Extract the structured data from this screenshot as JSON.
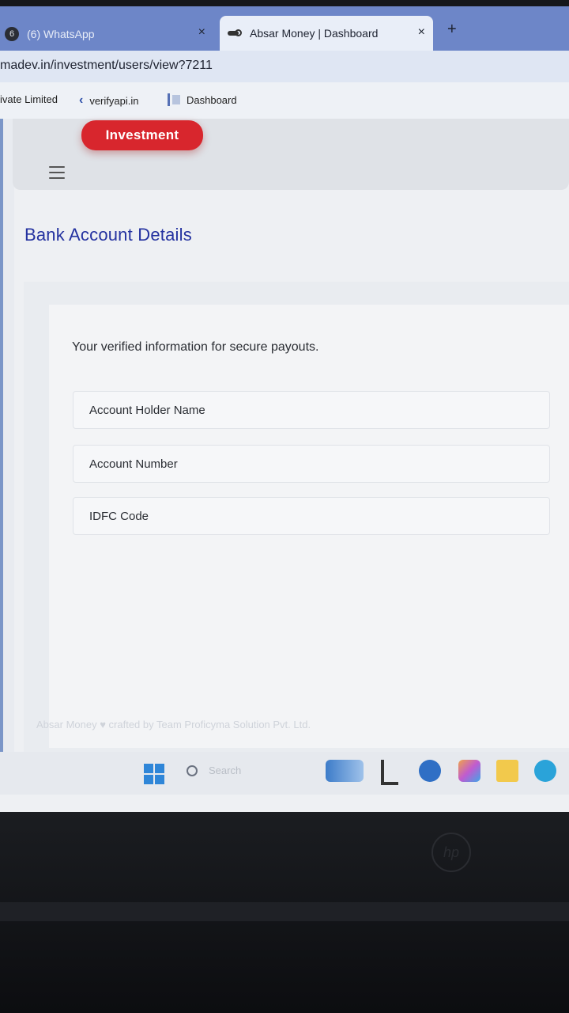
{
  "browser": {
    "tabs": [
      {
        "badge": "6",
        "title": "(6) WhatsApp",
        "active": false
      },
      {
        "title": "Absar Money | Dashboard",
        "active": true
      }
    ],
    "new_tab_label": "+",
    "close_label": "×",
    "url": "madev.in/investment/users/view?7211",
    "bookmarks": [
      {
        "label": "ivate Limited"
      },
      {
        "label": "verifyapi.in",
        "icon": "chevron-left-icon"
      },
      {
        "label": "Dashboard",
        "icon": "dashboard-icon"
      }
    ]
  },
  "app": {
    "menu_icon": "hamburger-icon",
    "section_pill": "Investment",
    "page_title": "Bank Account Details",
    "subtitle": "Your verified information for secure payouts.",
    "fields": [
      {
        "label": "Account Holder Name"
      },
      {
        "label": "Account Number"
      },
      {
        "label": "IDFC Code"
      }
    ],
    "footer": "Absar Money ♥ crafted by Team Proficyma Solution Pvt. Ltd.",
    "accent_color": "#d8262d",
    "title_color": "#2432a0"
  },
  "taskbar": {
    "search_placeholder": "Search"
  },
  "device": {
    "brand_mark": "hp"
  }
}
